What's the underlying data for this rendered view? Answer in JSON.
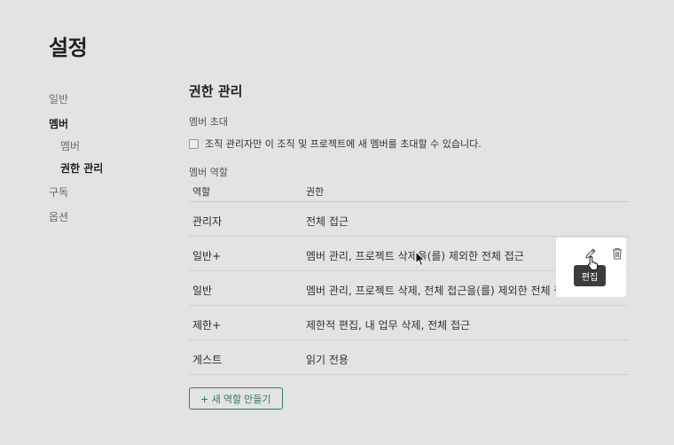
{
  "page": {
    "title": "설정"
  },
  "nav": {
    "general": "일반",
    "members": "멤버",
    "members_sub": "멤버",
    "permissions_sub": "권한 관리",
    "subscription": "구독",
    "options": "옵션"
  },
  "main": {
    "title": "권한 관리",
    "invite_label": "멤버 초대",
    "invite_checkbox": "조직 관리자만 이 조직 및 프로젝트에 새 멤버를 초대할 수 있습니다.",
    "invite_checked": false,
    "roles_label": "멤버 역할",
    "table": {
      "headers": {
        "role": "역할",
        "permission": "권한"
      },
      "rows": [
        {
          "role": "관리자",
          "permission": "전체 접근"
        },
        {
          "role": "일반+",
          "permission": "멤버 관리, 프로젝트 삭제을(를) 제외한 전체 접근"
        },
        {
          "role": "일반",
          "permission": "멤버 관리, 프로젝트 삭제, 전체 접근을(를) 제외한 전체 접근"
        },
        {
          "role": "제한+",
          "permission": "제한적 편집, 내 업무 삭제, 전체 접근"
        },
        {
          "role": "게스트",
          "permission": "읽기 전용"
        }
      ]
    },
    "add_role_button": "새 역할 만들기"
  },
  "popover": {
    "tooltip": "편집",
    "edit_icon": "pencil-icon",
    "delete_icon": "trash-icon"
  },
  "colors": {
    "accent": "#2f7d63",
    "background": "#e3e3e3",
    "tooltip": "#3c3c3c"
  }
}
